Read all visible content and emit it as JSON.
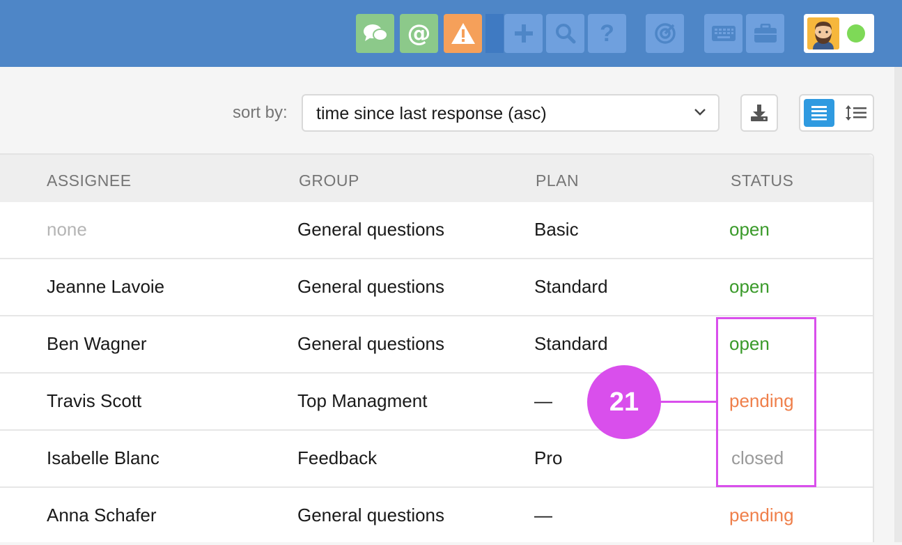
{
  "topbar": {
    "buttons": [
      {
        "icon": "chat-bubbles-icon",
        "color": "#8cc98a"
      },
      {
        "icon": "at-sign-icon",
        "color": "#8cc98a"
      },
      {
        "icon": "warning-icon",
        "color": "#f5a05a"
      },
      {
        "icon": "plus-icon",
        "color": "#6fa0de"
      },
      {
        "icon": "search-icon",
        "color": "#6fa0de"
      },
      {
        "icon": "help-icon",
        "color": "#6fa0de"
      },
      {
        "icon": "target-icon",
        "color": "#6fa0de"
      },
      {
        "icon": "keyboard-icon",
        "color": "#6fa0de"
      },
      {
        "icon": "briefcase-icon",
        "color": "#6fa0de"
      }
    ],
    "status_color": "#7ed957"
  },
  "toolbar": {
    "sort_label": "sort by:",
    "sort_value": "time since last response (asc)"
  },
  "table": {
    "columns": [
      "ASSIGNEE",
      "GROUP",
      "PLAN",
      "STATUS"
    ],
    "rows": [
      {
        "assignee": "none",
        "group": "General questions",
        "plan": "Basic",
        "status": "open"
      },
      {
        "assignee": "Jeanne Lavoie",
        "group": "General questions",
        "plan": "Standard",
        "status": "open"
      },
      {
        "assignee": "Ben Wagner",
        "group": "General questions",
        "plan": "Standard",
        "status": "open"
      },
      {
        "assignee": "Travis Scott",
        "group": "Top Managment",
        "plan": "—",
        "status": "pending"
      },
      {
        "assignee": "Isabelle Blanc",
        "group": "Feedback",
        "plan": "Pro",
        "status": "closed"
      },
      {
        "assignee": "Anna Schafer",
        "group": "General questions",
        "plan": "—",
        "status": "pending"
      }
    ]
  },
  "annotation": {
    "number": "21",
    "color": "#d94fec"
  }
}
